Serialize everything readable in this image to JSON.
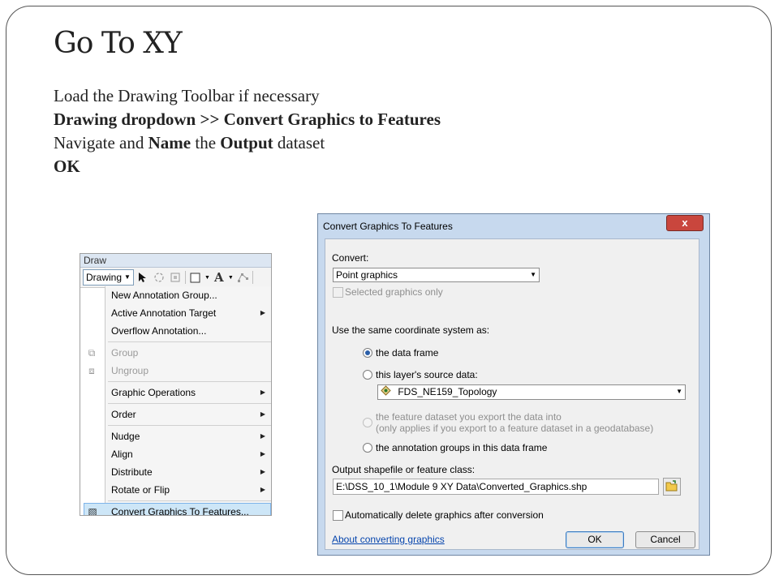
{
  "slide": {
    "title": "Go To XY",
    "lines": [
      [
        {
          "text": "Load the Drawing Toolbar if necessary",
          "bold": false
        }
      ],
      [
        {
          "text": "Drawing dropdown >> Convert Graphics to Features",
          "bold": true
        }
      ],
      [
        {
          "text": "Navigate and ",
          "bold": false
        },
        {
          "text": "Name",
          "bold": true
        },
        {
          "text": " the ",
          "bold": false
        },
        {
          "text": "Output",
          "bold": true
        },
        {
          "text": " dataset",
          "bold": false
        }
      ],
      [
        {
          "text": "OK",
          "bold": true
        }
      ]
    ]
  },
  "draw_toolbar": {
    "window_title": "Draw",
    "dropdown_label": "Drawing",
    "tools": [
      "select-arrow-icon",
      "rotate-icon",
      "zoom-to-selected-icon",
      "rectangle-icon",
      "text-A-icon",
      "edit-vertices-icon"
    ],
    "text_tool_glyph": "A",
    "menu": [
      {
        "label": "New Annotation Group...",
        "submenu": false,
        "disabled": false,
        "icon": ""
      },
      {
        "label": "Active Annotation Target",
        "submenu": true,
        "disabled": false,
        "icon": ""
      },
      {
        "label": "Overflow Annotation...",
        "submenu": false,
        "disabled": false,
        "icon": ""
      },
      {
        "sep": true
      },
      {
        "label": "Group",
        "submenu": false,
        "disabled": true,
        "icon": "group-icon"
      },
      {
        "label": "Ungroup",
        "submenu": false,
        "disabled": true,
        "icon": "ungroup-icon"
      },
      {
        "sep": true
      },
      {
        "label": "Graphic Operations",
        "submenu": true,
        "disabled": false,
        "icon": ""
      },
      {
        "sep": true
      },
      {
        "label": "Order",
        "submenu": true,
        "disabled": false,
        "icon": ""
      },
      {
        "sep": true
      },
      {
        "label": "Nudge",
        "submenu": true,
        "disabled": false,
        "icon": ""
      },
      {
        "label": "Align",
        "submenu": true,
        "disabled": false,
        "icon": ""
      },
      {
        "label": "Distribute",
        "submenu": true,
        "disabled": false,
        "icon": ""
      },
      {
        "label": "Rotate or Flip",
        "submenu": true,
        "disabled": false,
        "icon": ""
      },
      {
        "sep": true
      },
      {
        "label": "Convert Graphics To Features...",
        "submenu": false,
        "disabled": false,
        "icon": "convert-graphics-icon",
        "highlight": true
      }
    ]
  },
  "dialog": {
    "title": "Convert Graphics To Features",
    "close_glyph": "x",
    "convert_label": "Convert:",
    "convert_value": "Point graphics",
    "selected_only_label": "Selected graphics only",
    "coord_label": "Use the same coordinate system as:",
    "radio_data_frame": "the data frame",
    "radio_layer_source": "this layer's source data:",
    "layer_value": "FDS_NE159_Topology",
    "radio_feature_dataset_line1": "the feature dataset you export the data into",
    "radio_feature_dataset_line2": "(only applies if you export to a feature dataset in a geodatabase)",
    "radio_annotation_groups": "the annotation groups in this data frame",
    "output_label": "Output shapefile or feature class:",
    "output_path": "E:\\DSS_10_1\\Module 9 XY Data\\Converted_Graphics.shp",
    "auto_delete_label": "Automatically delete graphics after conversion",
    "help_link": "About converting graphics",
    "ok_label": "OK",
    "cancel_label": "Cancel"
  }
}
